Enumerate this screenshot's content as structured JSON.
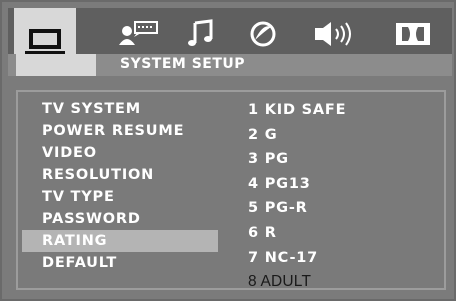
{
  "tabs": [
    {
      "icon": "monitor-icon",
      "active": true
    },
    {
      "icon": "user-speech-icon",
      "active": false
    },
    {
      "icon": "music-note-icon",
      "active": false
    },
    {
      "icon": "circle-slash-icon",
      "active": false
    },
    {
      "icon": "speaker-icon",
      "active": false
    },
    {
      "icon": "dolby-icon",
      "active": false
    }
  ],
  "header": {
    "title": "SYSTEM SETUP"
  },
  "menu": {
    "items": [
      "TV SYSTEM",
      "POWER RESUME",
      "VIDEO",
      "RESOLUTION",
      "TV TYPE",
      "PASSWORD",
      "RATING",
      "DEFAULT"
    ],
    "selected": "RATING"
  },
  "options": {
    "items": [
      "1 KID SAFE",
      "2 G",
      "3 PG",
      "4 PG13",
      "5 PG-R",
      "6 R",
      "7 NC-17",
      "8 ADULT"
    ],
    "current": "8 ADULT"
  },
  "colors": {
    "frame": "#7b7b7b",
    "icon_bar": "#5f5f5f",
    "active_tab": "#d8d8d8",
    "highlight": "#b4b4b4",
    "text": "#ffffff"
  }
}
